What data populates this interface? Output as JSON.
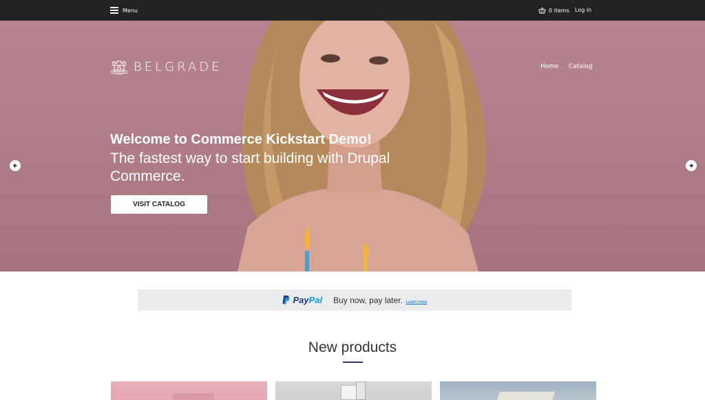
{
  "topbar": {
    "menu_label": "Menu",
    "cart_label": "0 items",
    "login_label": "Log in"
  },
  "header": {
    "brand": "BELGRADE",
    "nav": [
      {
        "label": "Home"
      },
      {
        "label": "Catalog"
      }
    ]
  },
  "hero": {
    "title": "Welcome to Commerce Kickstart Demo!",
    "subtitle": "The fastest way to start building with Drupal Commerce.",
    "cta_label": "VISIT CATALOG",
    "active_slide": 1,
    "slide_count": 2
  },
  "paypal": {
    "brand_pay": "Pay",
    "brand_pal": "Pal",
    "message": "Buy now, pay later.",
    "learn_more": "Learn more"
  },
  "products": {
    "section_title": "New products"
  },
  "colors": {
    "topbar": "#222222",
    "hero_tint": "#b7848f",
    "accent": "#2d3b6a",
    "paypal_dark": "#253b80",
    "paypal_light": "#179bd7"
  }
}
